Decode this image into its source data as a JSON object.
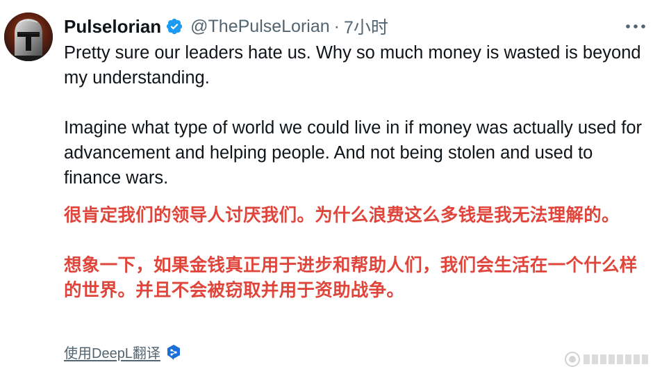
{
  "tweet": {
    "display_name": "Pulselorian",
    "handle": "@ThePulseLorian",
    "separator": "·",
    "time": "7小时",
    "text_en": [
      "Pretty sure our leaders hate us. Why so much money is wasted is beyond my understanding.",
      "Imagine what type of world we could live in if money was actually used for advancement and helping people. And not being stolen and used to finance wars."
    ],
    "text_zh": [
      "很肯定我们的领导人讨厌我们。为什么浪费这么多钱是我无法理解的。",
      "想象一下，如果金钱真正用于进步和帮助人们，我们会生活在一个什么样的世界。并且不会被窃取并用于资助战争。"
    ],
    "translate_link": "使用DeepL翻译"
  },
  "icons": {
    "avatar": "mandalorian-helmet-avatar",
    "verified": "verified-badge-icon",
    "more": "more-horizontal-icon",
    "deepl": "deepl-icon"
  },
  "colors": {
    "text": "#0f1419",
    "secondary": "#536471",
    "verified_blue": "#1d9bf0",
    "translation_red": "#e0453b",
    "deepl_blue": "#1d6fd8"
  }
}
